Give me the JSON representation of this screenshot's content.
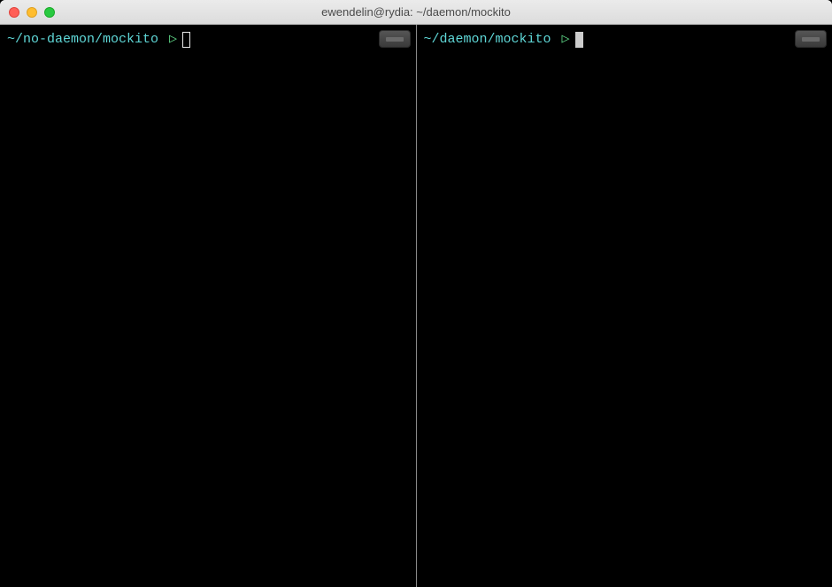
{
  "window": {
    "title": "ewendelin@rydia: ~/daemon/mockito"
  },
  "panes": {
    "left": {
      "prompt_path": "~/no-daemon/mockito",
      "prompt_symbol": "▷",
      "active": false
    },
    "right": {
      "prompt_path": "~/daemon/mockito",
      "prompt_symbol": "▷",
      "active": true
    }
  }
}
